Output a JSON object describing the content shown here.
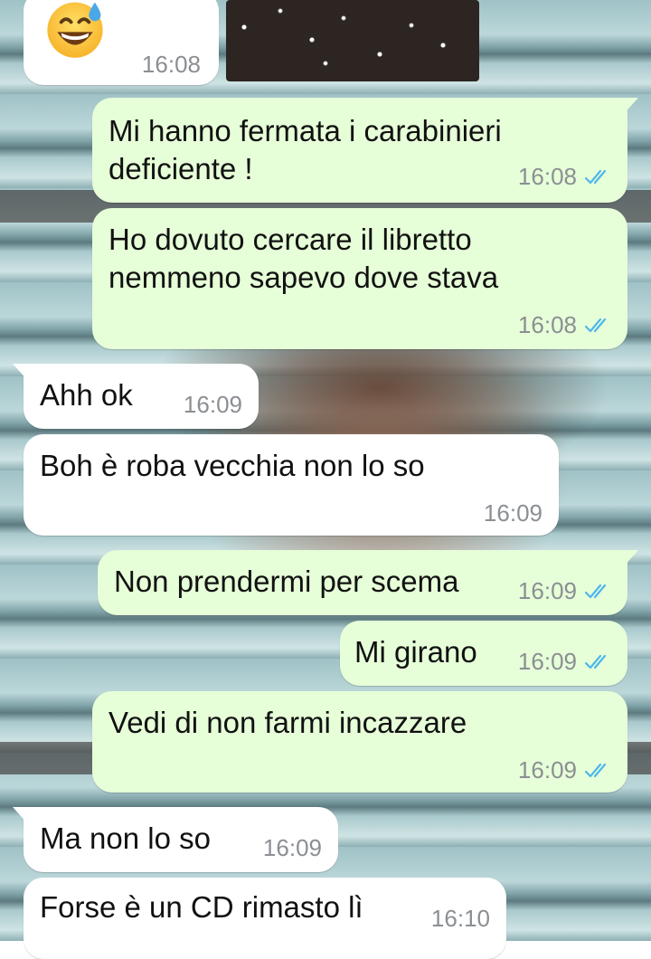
{
  "messages": [
    {
      "direction": "in",
      "emoji": "grinning-face-with-sweat",
      "time": "16:08"
    },
    {
      "direction": "out",
      "text": "Mi hanno fermata i carabinieri\ndeficiente !",
      "time": "16:08",
      "status": "read"
    },
    {
      "direction": "out",
      "text": "Ho dovuto cercare il libretto\nnemmeno sapevo dove stava",
      "time": "16:08",
      "status": "read"
    },
    {
      "direction": "in",
      "text": "Ahh ok",
      "time": "16:09"
    },
    {
      "direction": "in",
      "text": "Boh è roba vecchia non lo so",
      "time": "16:09"
    },
    {
      "direction": "out",
      "text": "Non prendermi per scema",
      "time": "16:09",
      "status": "read"
    },
    {
      "direction": "out",
      "text": "Mi girano",
      "time": "16:09",
      "status": "read"
    },
    {
      "direction": "out",
      "text": "Vedi di non farmi incazzare",
      "time": "16:09",
      "status": "read"
    },
    {
      "direction": "in",
      "text": "Ma non lo so",
      "time": "16:09"
    },
    {
      "direction": "in",
      "text": "Forse è un CD rimasto lì",
      "time": "16:10"
    }
  ],
  "colors": {
    "outgoing_bubble": "#e6ffd8",
    "incoming_bubble": "#ffffff",
    "read_ticks": "#4fb6ec",
    "timestamp": "#8b8f93"
  }
}
